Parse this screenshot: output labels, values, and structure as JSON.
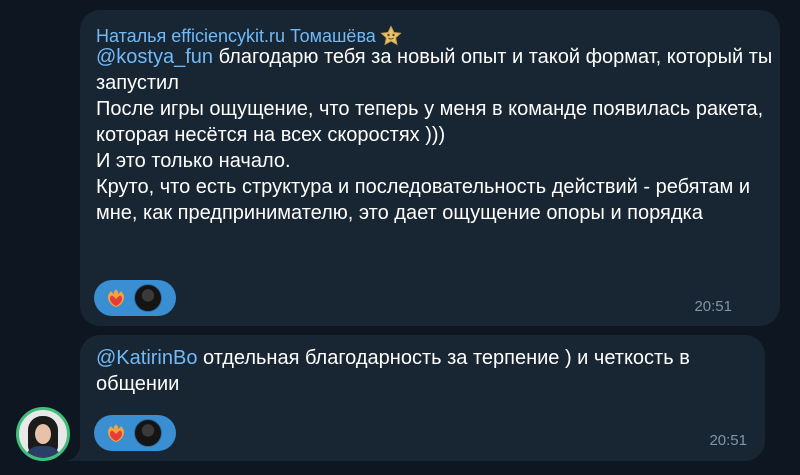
{
  "messages": [
    {
      "sender": "Наталья efficiencykit.ru Томашёва",
      "sender_badge_icon": "star-badge-icon",
      "mention": "@kostya_fun",
      "text": " благодарю тебя за новый опыт и такой формат, который ты запустил\nПосле игры ощущение, что теперь у меня в команде появилась ракета, которая несётся на всех скоростях )))\nИ это только начало.\nКруто, что есть структура и последовательность действий - ребятам и мне, как предпринимателю, это дает ощущение опоры и порядка",
      "reaction_icon": "heart-on-fire-icon",
      "time": "20:51"
    },
    {
      "mention": "@KatirinBo",
      "text": " отдельная благодарность за терпение ) и четкость в общении",
      "reaction_icon": "heart-on-fire-icon",
      "time": "20:51"
    }
  ],
  "colors": {
    "background": "#0e1621",
    "bubble": "#182533",
    "accent": "#71baf6",
    "reaction_pill": "#3a8fd2",
    "time": "#8095a8",
    "avatar_ring": "#3dbf7a"
  }
}
